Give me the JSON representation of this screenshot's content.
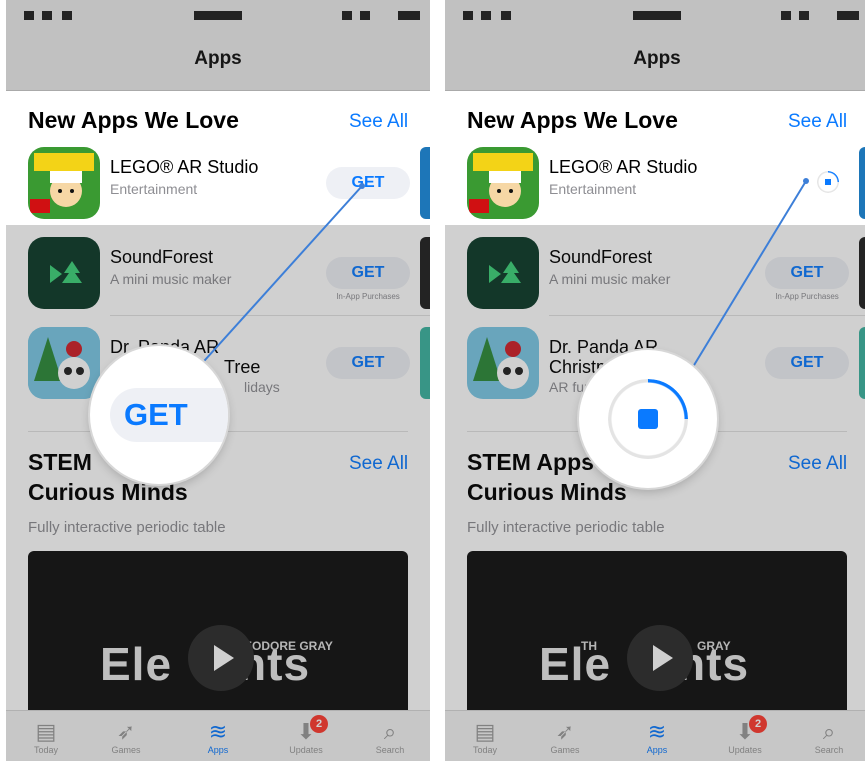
{
  "nav_title": "Apps",
  "section1": {
    "title": "New Apps We Love",
    "see_all": "See All"
  },
  "apps": [
    {
      "name": "LEGO® AR Studio",
      "subtitle": "Entertainment",
      "button": "GET"
    },
    {
      "name": "SoundForest",
      "subtitle": "A mini music maker",
      "button": "GET",
      "note": "In-App Purchases"
    },
    {
      "name": "Dr. Panda AR",
      "name2": "Christmas Tree",
      "subtitle": "AR fun for the holidays",
      "button": "GET"
    }
  ],
  "left_partial": {
    "app3_name2": "Tree",
    "app3_sub": "lidays"
  },
  "right_partial": {
    "app3_name2": "Christmas Tree",
    "app3_sub": "AR fun"
  },
  "section2": {
    "title_line1": "STEM Apps for",
    "title_line2": "Curious Minds",
    "see_all": "See All",
    "subtitle": "Fully interactive periodic table"
  },
  "stem_left_title": "STEM",
  "stem_right_title": "STEM Apps",
  "video": {
    "brand": "Elements",
    "small": "THEODORE GRAY",
    "small_right": "GRAY",
    "the": "THE",
    "left_title": "Ele",
    "right_title": "nts",
    "right_left": "Ele",
    "right_small_left": "TH"
  },
  "magnifier_label": "GET",
  "tabs": [
    {
      "icon": "today-icon",
      "label": "Today",
      "glyph": "▤"
    },
    {
      "icon": "games-icon",
      "label": "Games",
      "glyph": "🚀"
    },
    {
      "icon": "apps-icon",
      "label": "Apps",
      "glyph": "≋"
    },
    {
      "icon": "updates-icon",
      "label": "Updates",
      "glyph": "⬇",
      "badge": "2"
    },
    {
      "icon": "search-icon",
      "label": "Search",
      "glyph": "⌕"
    }
  ],
  "download_progress": 0.25,
  "colors": {
    "accent": "#0a7aff",
    "badge": "#ff3b30",
    "soundforest": "#0d3b2a",
    "lego": "#2f8a2f"
  }
}
